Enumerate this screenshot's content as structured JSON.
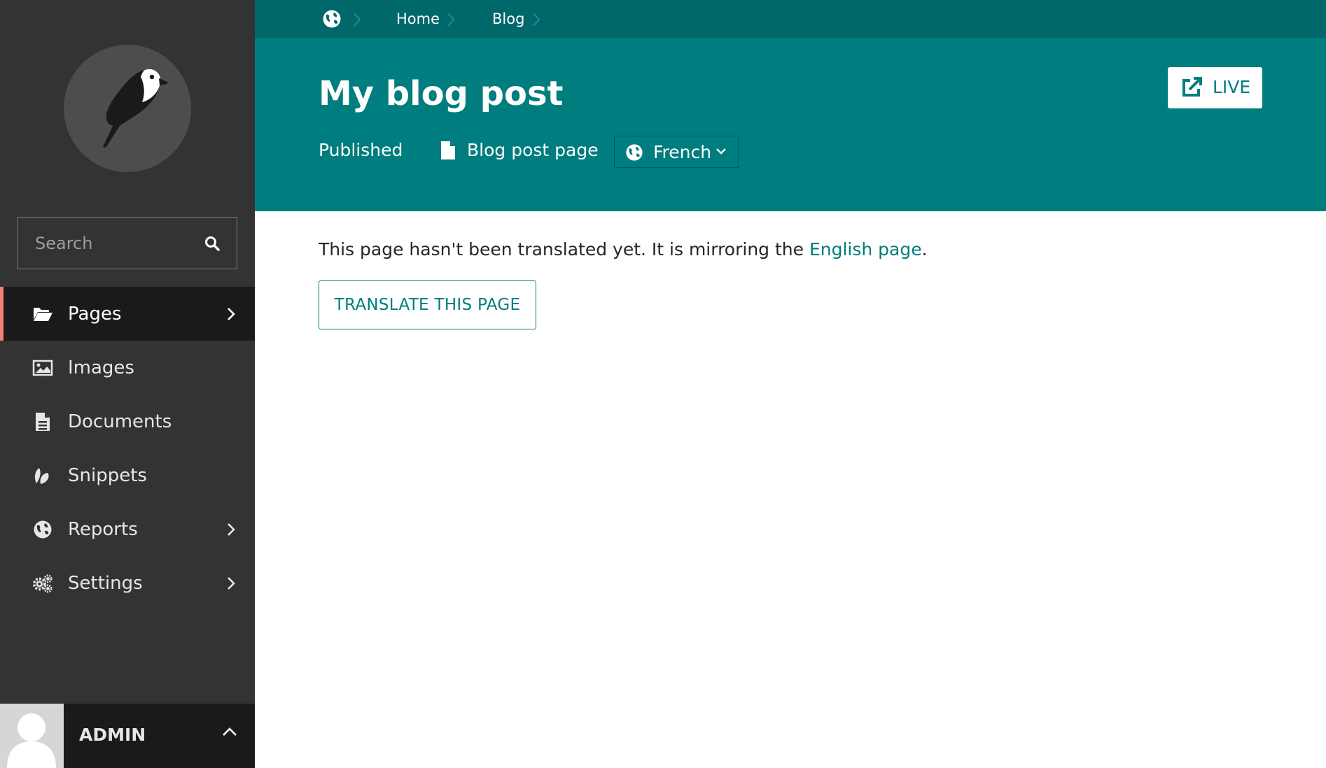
{
  "sidebar": {
    "logo_icon": "wagtail-bird-logo",
    "search": {
      "placeholder": "Search",
      "icon": "search-icon"
    },
    "items": [
      {
        "label": "Pages",
        "icon": "folder-open-icon",
        "active": true,
        "has_submenu": true
      },
      {
        "label": "Images",
        "icon": "image-icon",
        "active": false,
        "has_submenu": false
      },
      {
        "label": "Documents",
        "icon": "document-icon",
        "active": false,
        "has_submenu": false
      },
      {
        "label": "Snippets",
        "icon": "snippet-icon",
        "active": false,
        "has_submenu": false
      },
      {
        "label": "Reports",
        "icon": "globe-icon",
        "active": false,
        "has_submenu": true
      },
      {
        "label": "Settings",
        "icon": "cogs-icon",
        "active": false,
        "has_submenu": true
      }
    ],
    "account": {
      "name": "ADMIN",
      "icon": "chevron-up-icon"
    }
  },
  "header": {
    "breadcrumb": [
      {
        "label": "",
        "icon": "globe-icon"
      },
      {
        "label": "Home"
      },
      {
        "label": "Blog"
      }
    ],
    "title": "My blog post",
    "status": "Published",
    "page_type": "Blog post page",
    "locale": "French",
    "live_label": "LIVE"
  },
  "content": {
    "notice_prefix": "This page hasn't been translated yet. It is mirroring the ",
    "notice_link": "English page",
    "notice_suffix": ".",
    "translate_button": "TRANSLATE THIS PAGE"
  },
  "colors": {
    "sidebar_bg": "#333333",
    "header_bg": "#007d7e",
    "breadcrumb_bg": "#00676a",
    "active_indicator": "#f37e77",
    "accent": "#007d7e"
  }
}
